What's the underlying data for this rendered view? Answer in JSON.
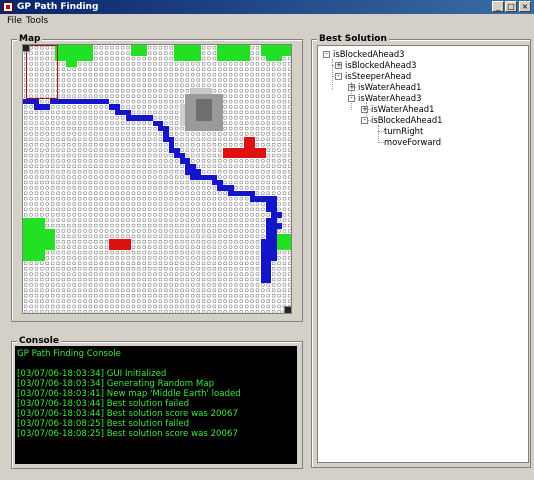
{
  "window": {
    "title": "GP Path Finding",
    "minimize": "_",
    "maximize": "□",
    "close": "×"
  },
  "menu": {
    "items": [
      "File",
      "Tools"
    ]
  },
  "map": {
    "title": "Map"
  },
  "console": {
    "title": "Console",
    "lines": [
      "GP Path Finding Console",
      "",
      "[03/07/06-18:03:34] GUI Initialized",
      "[03/07/06-18:03:34] Generating Random Map",
      "[03/07/06-18:03:41] New map 'Middle Earth' loaded",
      "[03/07/06-18:03:44] Best solution failed",
      "[03/07/06-18:03:44] Best solution score was 20067",
      "[03/07/06-18:08:25] Best solution failed",
      "[03/07/06-18:08:25] Best solution score was 20067"
    ],
    "text_color": "#3dea3d"
  },
  "solution": {
    "title": "Best Solution",
    "tree": [
      {
        "label": "isBlockedAhead3",
        "level": 0,
        "toggle": "-"
      },
      {
        "label": "isBlockedAhead3",
        "level": 1,
        "toggle": "+"
      },
      {
        "label": "isSteeperAhead",
        "level": 1,
        "toggle": "-"
      },
      {
        "label": "isWaterAhead1",
        "level": 2,
        "toggle": "+"
      },
      {
        "label": "isWaterAhead3",
        "level": 2,
        "toggle": "-"
      },
      {
        "label": "isWaterAhead1",
        "level": 3,
        "toggle": "+"
      },
      {
        "label": "isBlockedAhead1",
        "level": 3,
        "toggle": "-"
      },
      {
        "label": "turnRight",
        "level": 4,
        "toggle": ""
      },
      {
        "label": "moveForward",
        "level": 4,
        "toggle": ""
      }
    ]
  },
  "colors": {
    "water": "#1414c8",
    "forest": "#22e022",
    "obstacle": "#dd1111",
    "mountain": "#9a9a9a",
    "trail": "#aa1111"
  }
}
